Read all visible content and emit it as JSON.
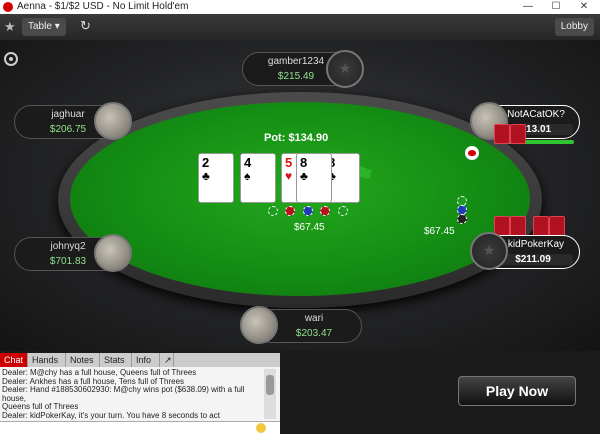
{
  "window": {
    "title": "Aenna - $1/$2 USD - No Limit Hold'em",
    "controls": [
      "minimize",
      "maximize",
      "close"
    ]
  },
  "toolbar": {
    "table_label": "Table",
    "lobby_label": "Lobby"
  },
  "pot": {
    "label": "Pot: $134.90"
  },
  "board": [
    {
      "rank": "2",
      "suit": "♣",
      "color": "black"
    },
    {
      "rank": "4",
      "suit": "♠",
      "color": "black"
    },
    {
      "rank": "5",
      "suit": "♥",
      "color": "red"
    },
    {
      "rank": "8",
      "suit": "♣",
      "color": "black"
    },
    {
      "rank": "8",
      "suit": "♣",
      "color": "black"
    }
  ],
  "bets": {
    "center_amount": "$67.45",
    "right_amount": "$67.45"
  },
  "seats": [
    {
      "name": "gamber1234",
      "stack": "$215.49"
    },
    {
      "name": "jaghuar",
      "stack": "$206.75"
    },
    {
      "name": "NotACatOK?",
      "stack": "$313.01"
    },
    {
      "name": "johnyq2",
      "stack": "$701.83"
    },
    {
      "name": "kidPokerKay",
      "stack": "$211.09"
    },
    {
      "name": "wari",
      "stack": "$203.47"
    }
  ],
  "chat": {
    "tabs": [
      "Chat",
      "Hands",
      "Notes",
      "Stats",
      "Info"
    ],
    "active_tab": "Chat",
    "lines": [
      "Dealer: M@chy has a full house, Queens full of Threes",
      "Dealer: Ankhes has a full house, Tens full of Threes",
      "Dealer: Hand #188530602930: M@chy wins pot ($638.09) with a full house,",
      "   Queens full of Threes",
      "Dealer: kidPokerKay, it's your turn. You have 8 seconds to act"
    ]
  },
  "play_now_label": "Play Now",
  "colors": {
    "felt": "#138a13",
    "accent_red": "#d40000",
    "stack_green": "#8fe38f"
  }
}
